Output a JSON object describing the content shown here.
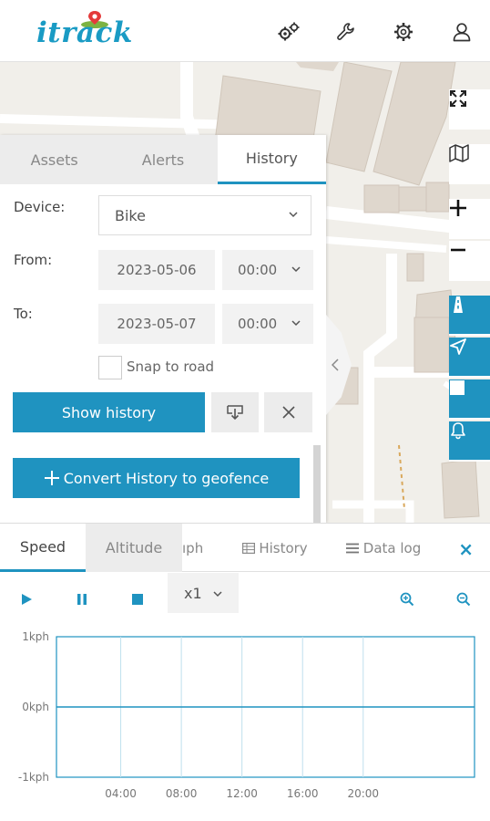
{
  "header": {
    "logo_text": "itrack",
    "icons": [
      "gears-icon",
      "wrench-icon",
      "gear-icon",
      "user-icon"
    ]
  },
  "tabs": [
    {
      "label": "Assets",
      "active": false
    },
    {
      "label": "Alerts",
      "active": false
    },
    {
      "label": "History",
      "active": true
    }
  ],
  "form": {
    "device_label": "Device:",
    "device_value": "Bike",
    "from_label": "From:",
    "from_date": "2023-05-06",
    "from_time": "00:00",
    "to_label": "To:",
    "to_date": "2023-05-07",
    "to_time": "00:00",
    "snap_label": "Snap to road",
    "snap_checked": false,
    "show_history": "Show history",
    "convert_geofence": "Convert History to geofence"
  },
  "bottom": {
    "tabs": {
      "speed": "Speed",
      "altitude": "Altitude",
      "graph_partial": "ıph",
      "history": "History",
      "data_log": "Data log"
    },
    "close": "×",
    "speed_multiplier": "x1"
  },
  "colors": {
    "accent": "#1f93c0",
    "logo": "#1a9bc4",
    "pin": "#e43b3b",
    "map_bg": "#f1efea",
    "building": "#dfd7cd"
  },
  "chart_data": {
    "type": "line",
    "title": "",
    "xlabel": "",
    "ylabel": "",
    "y_ticks": [
      "1kph",
      "0kph",
      "-1kph"
    ],
    "ylim": [
      -1,
      1
    ],
    "x_ticks": [
      "04:00",
      "08:00",
      "12:00",
      "16:00",
      "20:00"
    ],
    "series": [
      {
        "x": [
          "00:00",
          "24:00"
        ],
        "values": [
          0,
          0
        ]
      }
    ],
    "grid": true
  }
}
